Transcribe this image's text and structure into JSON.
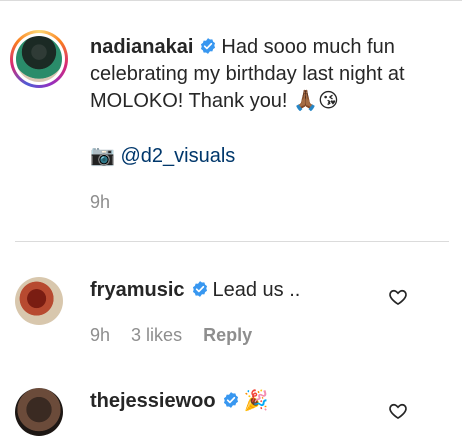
{
  "caption": {
    "username": "nadianakai",
    "text": "Had sooo much fun celebrating my birthday last night at MOLOKO! Thank you!",
    "emojis": "🙏🏾😘",
    "camera_emoji": "📷",
    "mention": "@d2_visuals",
    "time": "9h"
  },
  "comments": [
    {
      "username": "fryamusic",
      "text": "Lead us ..",
      "time": "9h",
      "likes": "3 likes",
      "reply": "Reply"
    },
    {
      "username": "thejessiewoo",
      "text": "",
      "emoji": "🎉"
    }
  ],
  "icons": {
    "verified_color": "#3897f0",
    "heart": "heart-outline-icon"
  }
}
